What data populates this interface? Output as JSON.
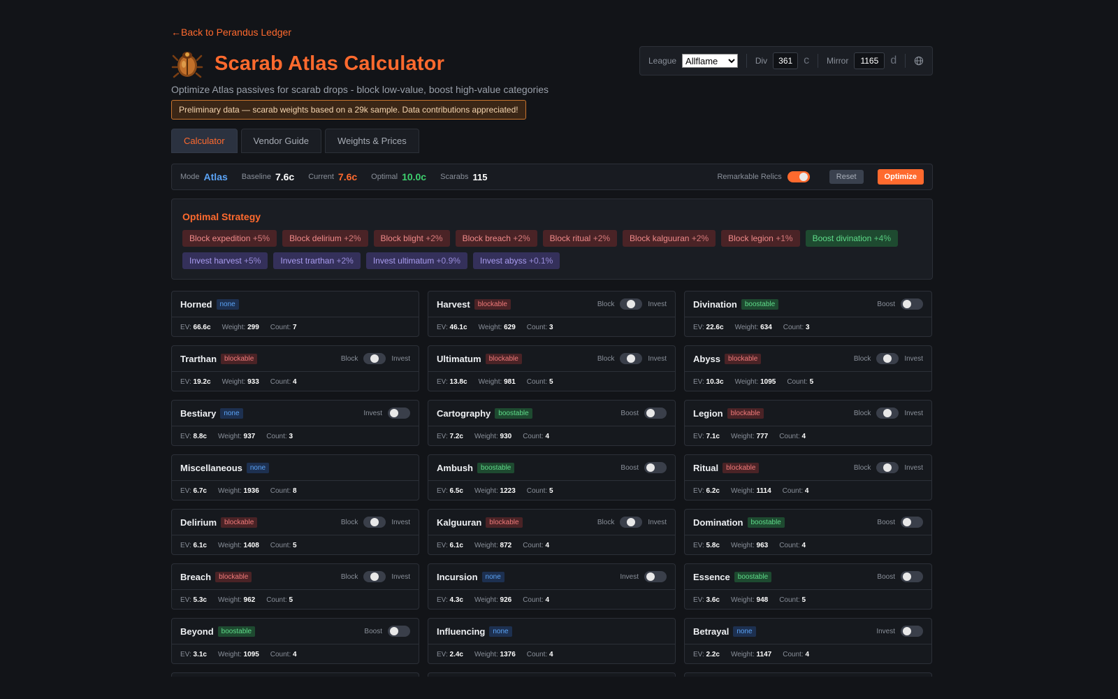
{
  "header": {
    "back_link": "←Back to Perandus Ledger",
    "title": "Scarab Atlas Calculator",
    "subtitle": "Optimize Atlas passives for scarab drops - block low-value, boost high-value categories",
    "notice": "Preliminary data — scarab weights based on a 29k sample. Data contributions appreciated!"
  },
  "settings": {
    "league_label": "League",
    "league_value": "Allflame",
    "div_label": "Div",
    "div_value": "361",
    "div_unit": "c",
    "mirror_label": "Mirror",
    "mirror_value": "1165",
    "mirror_unit": "d"
  },
  "tabs": [
    {
      "label": "Calculator"
    },
    {
      "label": "Vendor Guide"
    },
    {
      "label": "Weights & Prices"
    }
  ],
  "status": {
    "mode_label": "Mode",
    "mode_value": "Atlas",
    "baseline_label": "Baseline",
    "baseline_value": "7.6c",
    "current_label": "Current",
    "current_value": "7.6c",
    "optimal_label": "Optimal",
    "optimal_value": "10.0c",
    "scarabs_label": "Scarabs",
    "scarabs_value": "115",
    "relics_label": "Remarkable Relics",
    "relics_on": true,
    "reset_label": "Reset",
    "optimize_label": "Optimize"
  },
  "strategy": {
    "title": "Optimal Strategy",
    "chips": [
      {
        "type": "block",
        "text": "Block expedition",
        "pct": "+5%"
      },
      {
        "type": "block",
        "text": "Block delirium",
        "pct": "+2%"
      },
      {
        "type": "block",
        "text": "Block blight",
        "pct": "+2%"
      },
      {
        "type": "block",
        "text": "Block breach",
        "pct": "+2%"
      },
      {
        "type": "block",
        "text": "Block ritual",
        "pct": "+2%"
      },
      {
        "type": "block",
        "text": "Block kalguuran",
        "pct": "+2%"
      },
      {
        "type": "block",
        "text": "Block legion",
        "pct": "+1%"
      },
      {
        "type": "boost",
        "text": "Boost divination",
        "pct": "+4%"
      },
      {
        "type": "invest",
        "text": "Invest harvest",
        "pct": "+5%"
      },
      {
        "type": "invest",
        "text": "Invest trarthan",
        "pct": "+2%"
      },
      {
        "type": "invest",
        "text": "Invest ultimatum",
        "pct": "+0.9%"
      },
      {
        "type": "invest",
        "text": "Invest abyss",
        "pct": "+0.1%"
      }
    ]
  },
  "labels": {
    "ev": "EV:",
    "weight": "Weight:",
    "count": "Count:",
    "block": "Block",
    "invest": "Invest",
    "boost": "Boost"
  },
  "cards": [
    {
      "name": "Horned",
      "badge": "none",
      "ctl": "",
      "ev": "66.6c",
      "weight": "299",
      "count": "7"
    },
    {
      "name": "Harvest",
      "badge": "blockable",
      "ctl": "block-invest",
      "ev": "46.1c",
      "weight": "629",
      "count": "3"
    },
    {
      "name": "Divination",
      "badge": "boostable",
      "ctl": "boost",
      "ev": "22.6c",
      "weight": "634",
      "count": "3"
    },
    {
      "name": "Trarthan",
      "badge": "blockable",
      "ctl": "block-invest",
      "ev": "19.2c",
      "weight": "933",
      "count": "4"
    },
    {
      "name": "Ultimatum",
      "badge": "blockable",
      "ctl": "block-invest",
      "ev": "13.8c",
      "weight": "981",
      "count": "5"
    },
    {
      "name": "Abyss",
      "badge": "blockable",
      "ctl": "block-invest",
      "ev": "10.3c",
      "weight": "1095",
      "count": "5"
    },
    {
      "name": "Bestiary",
      "badge": "none",
      "ctl": "invest",
      "ev": "8.8c",
      "weight": "937",
      "count": "3"
    },
    {
      "name": "Cartography",
      "badge": "boostable",
      "ctl": "boost",
      "ev": "7.2c",
      "weight": "930",
      "count": "4"
    },
    {
      "name": "Legion",
      "badge": "blockable",
      "ctl": "block-invest",
      "ev": "7.1c",
      "weight": "777",
      "count": "4"
    },
    {
      "name": "Miscellaneous",
      "badge": "none",
      "ctl": "",
      "ev": "6.7c",
      "weight": "1936",
      "count": "8"
    },
    {
      "name": "Ambush",
      "badge": "boostable",
      "ctl": "boost",
      "ev": "6.5c",
      "weight": "1223",
      "count": "5"
    },
    {
      "name": "Ritual",
      "badge": "blockable",
      "ctl": "block-invest",
      "ev": "6.2c",
      "weight": "1114",
      "count": "4"
    },
    {
      "name": "Delirium",
      "badge": "blockable",
      "ctl": "block-invest",
      "ev": "6.1c",
      "weight": "1408",
      "count": "5"
    },
    {
      "name": "Kalguuran",
      "badge": "blockable",
      "ctl": "block-invest",
      "ev": "6.1c",
      "weight": "872",
      "count": "4"
    },
    {
      "name": "Domination",
      "badge": "boostable",
      "ctl": "boost",
      "ev": "5.8c",
      "weight": "963",
      "count": "4"
    },
    {
      "name": "Breach",
      "badge": "blockable",
      "ctl": "block-invest",
      "ev": "5.3c",
      "weight": "962",
      "count": "5"
    },
    {
      "name": "Incursion",
      "badge": "none",
      "ctl": "invest",
      "ev": "4.3c",
      "weight": "926",
      "count": "4"
    },
    {
      "name": "Essence",
      "badge": "boostable",
      "ctl": "boost",
      "ev": "3.6c",
      "weight": "948",
      "count": "5"
    },
    {
      "name": "Beyond",
      "badge": "boostable",
      "ctl": "boost",
      "ev": "3.1c",
      "weight": "1095",
      "count": "4"
    },
    {
      "name": "Influencing",
      "badge": "none",
      "ctl": "",
      "ev": "2.4c",
      "weight": "1376",
      "count": "4"
    },
    {
      "name": "Betrayal",
      "badge": "none",
      "ctl": "invest",
      "ev": "2.2c",
      "weight": "1147",
      "count": "4"
    }
  ]
}
